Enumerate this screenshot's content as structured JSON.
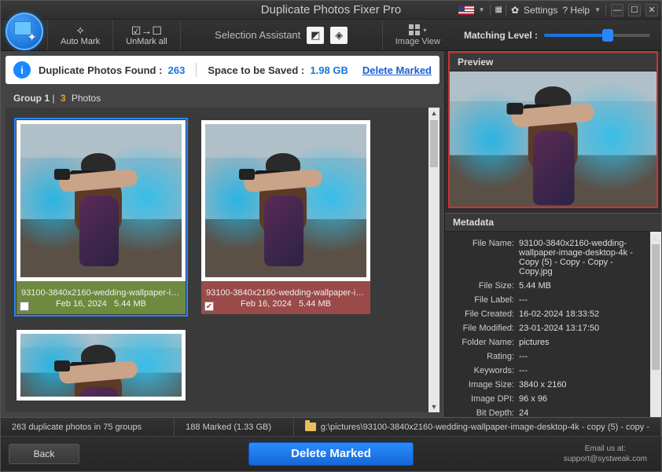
{
  "title_bar": {
    "app_title": "Duplicate Photos Fixer Pro",
    "settings": "Settings",
    "help": "? Help",
    "lang_flag": "US"
  },
  "toolbar": {
    "auto_mark": "Auto Mark",
    "unmark_all": "UnMark all",
    "selection_assistant": "Selection  Assistant",
    "image_view": "Image View",
    "matching_level": "Matching Level :"
  },
  "info": {
    "found_label": "Duplicate Photos Found :",
    "found_count": "263",
    "space_label": "Space to be Saved :",
    "space_value": "1.98 GB",
    "delete_marked": "Delete Marked"
  },
  "group_header": {
    "group_label": "Group 1",
    "count": "3",
    "photos_label": "Photos"
  },
  "cards": [
    {
      "filename": "93100-3840x2160-wedding-wallpaper-im…",
      "date": "Feb 16, 2024",
      "size": "5.44 MB",
      "checked": false,
      "color": "green",
      "selected": true
    },
    {
      "filename": "93100-3840x2160-wedding-wallpaper-im…",
      "date": "Feb 16, 2024",
      "size": "5.44 MB",
      "checked": true,
      "color": "red",
      "selected": false
    }
  ],
  "right": {
    "preview": "Preview",
    "metadata": "Metadata",
    "rows": [
      {
        "k": "File Name:",
        "v": "93100-3840x2160-wedding-wallpaper-image-desktop-4k - Copy (5) - Copy - Copy - Copy.jpg"
      },
      {
        "k": "File Size:",
        "v": "5.44 MB"
      },
      {
        "k": "File Label:",
        "v": "---"
      },
      {
        "k": "File Created:",
        "v": "16-02-2024 18:33:52"
      },
      {
        "k": "File Modified:",
        "v": "23-01-2024 13:17:50"
      },
      {
        "k": "Folder Name:",
        "v": "pictures"
      },
      {
        "k": "Rating:",
        "v": "---"
      },
      {
        "k": "Keywords:",
        "v": "---"
      },
      {
        "k": "Image Size:",
        "v": "3840 x 2160"
      },
      {
        "k": "Image DPI:",
        "v": "96 x 96"
      },
      {
        "k": "Bit Depth:",
        "v": "24"
      }
    ]
  },
  "status": {
    "dup": "263 duplicate photos in 75 groups",
    "marked": "188 Marked (1.33 GB)",
    "path": "g:\\pictures\\93100-3840x2160-wedding-wallpaper-image-desktop-4k - copy (5) - copy -"
  },
  "footer": {
    "back": "Back",
    "delete_marked": "Delete Marked",
    "email_label": "Email us at:",
    "email": "support@systweak.com"
  }
}
